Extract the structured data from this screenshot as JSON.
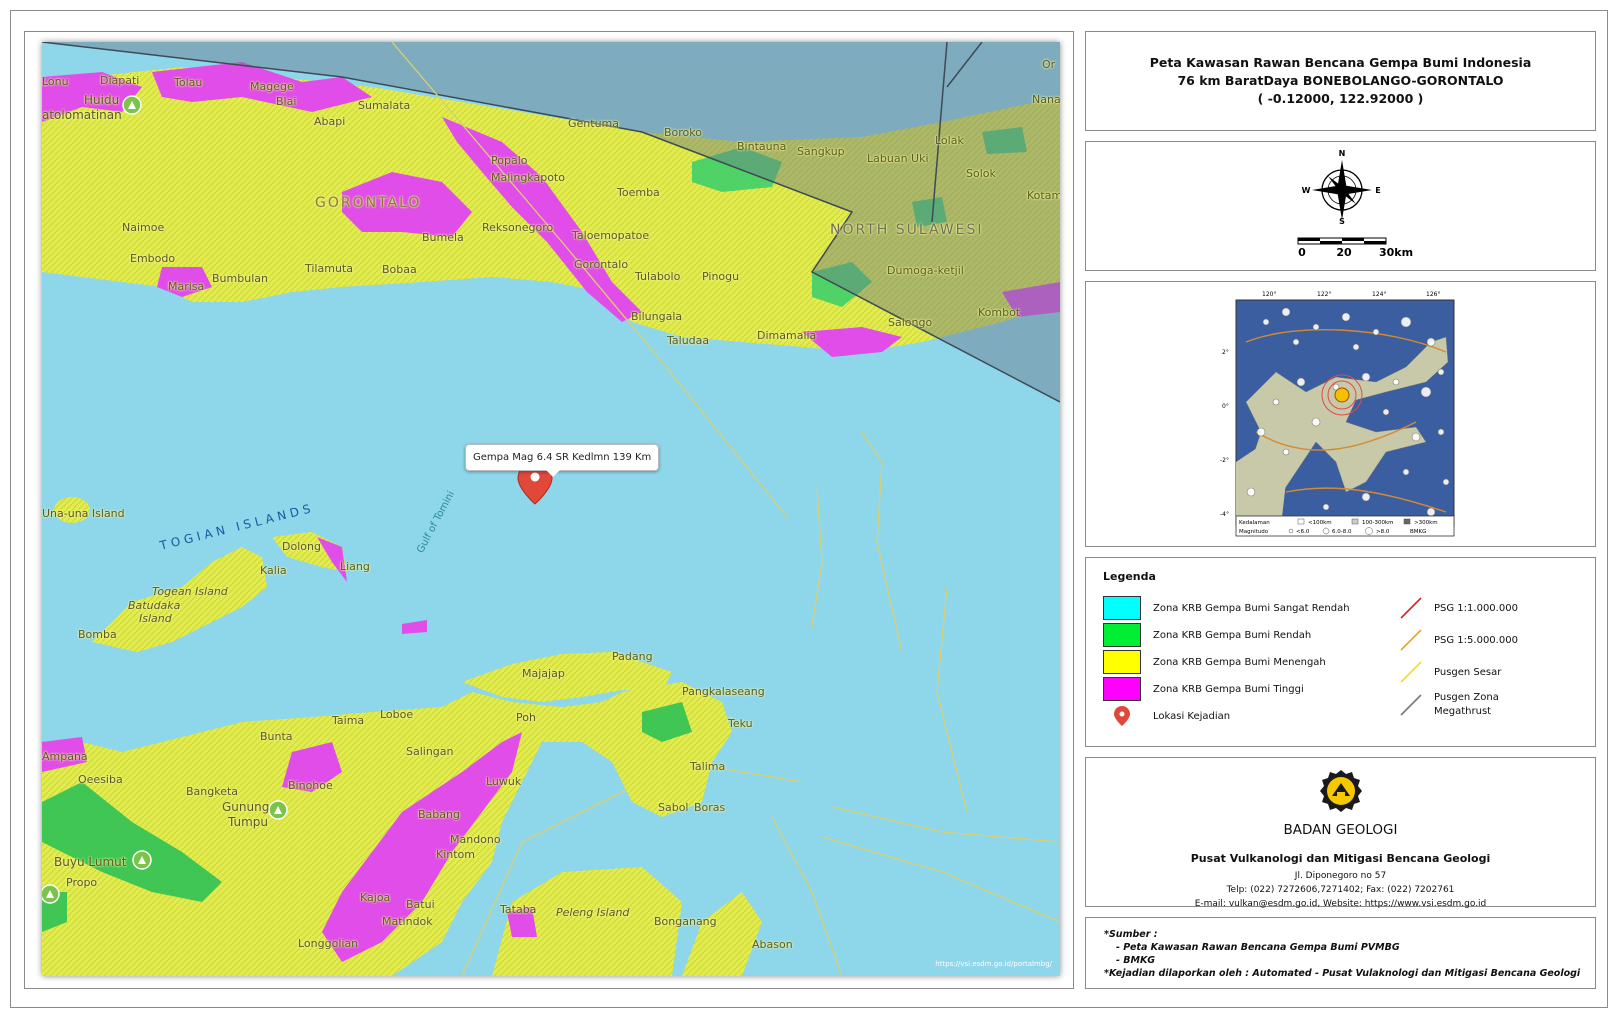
{
  "map": {
    "labels": {
      "gorontalo": "GORONTALO",
      "north_sulawesi": "NORTH SULAWESI",
      "togian_islands": "TOGIAN ISLANDS",
      "gulf_of_tomini": "Gulf of Tomini",
      "lonu": "Lonu",
      "diapati": "Diapati",
      "tolau": "Tolau",
      "magege": "Magege",
      "huidu": "Huidu",
      "atolomatinan": "atolomatinan",
      "blai": "Blai",
      "sumalata": "Sumalata",
      "abapi": "Abapi",
      "gentuma": "Gentuma",
      "boroko": "Boroko",
      "bintauna": "Bintauna",
      "sangkup": "Sangkup",
      "labuan_uki": "Labuan Uki",
      "lolak": "Lolak",
      "nana": "Nana",
      "solok": "Solok",
      "kotam": "Kotam",
      "or": "Or",
      "popalo": "Popalo",
      "malingkapoto": "Malingkapoto",
      "toemba": "Toemba",
      "naimoe": "Naimoe",
      "reksonegoro": "Reksonegoro",
      "bumela": "Bumela",
      "taloembatoe": "Taloemopatoe",
      "embodo": "Embodo",
      "gorontalo_city": "Gorontalo",
      "bumbulan": "Bumbulan",
      "tilamuta": "Tilamuta",
      "bobaa": "Bobaa",
      "marisa": "Marisa",
      "tulabolo": "Tulabolo",
      "pinogu": "Pinogu",
      "dumoga": "Dumoga-ketjil",
      "bilungala": "Bilungala",
      "dimamalia": "Dimamalia",
      "taludaa": "Taludaa",
      "salongo": "Salongo",
      "kombot": "Kombot",
      "una_una": "Una-una Island",
      "dolong": "Dolong",
      "kalia": "Kalia",
      "liang": "Liang",
      "togean": "Togean Island",
      "batudaka": "Batudaka",
      "island": "Island",
      "bomba": "Bomba",
      "padang": "Padang",
      "majajap": "Majajap",
      "pangkalaseang": "Pangkalaseang",
      "taima": "Taima",
      "loboe": "Loboe",
      "poh": "Poh",
      "teku": "Teku",
      "bunta": "Bunta",
      "salingan": "Salingan",
      "ampana": "Ampana",
      "oeesiba": "Oeesiba",
      "bangketa": "Bangketa",
      "binohoe": "Binohoe",
      "luwuk": "Luwuk",
      "talima": "Talima",
      "gunung": "Gunung",
      "tumpu": "Tumpu",
      "sabol": "Sabol",
      "boras": "Boras",
      "babang": "Babang",
      "buyu_lumut": "Buyu Lumut",
      "mandono": "Mandono",
      "kintom": "Kintom",
      "propo": "Propo",
      "kajoa": "Kajoa",
      "batui": "Batui",
      "matindok": "Matindok",
      "tataba": "Tataba",
      "peleng": "Peleng Island",
      "bonganang": "Bonganang",
      "longgolian": "Longgolian",
      "abason": "Abason"
    },
    "popup": "Gempa Mag 6.4 SR Kedlmn 139 Km",
    "credit": "https://vsi.esdm.go.id/portalmbg/"
  },
  "title": {
    "line1": "Peta Kawasan Rawan Bencana Gempa Bumi Indonesia",
    "line2": "76 km BaratDaya BONEBOLANGO-GORONTALO",
    "line3": "( -0.12000, 122.92000 )"
  },
  "compass": {
    "n": "N",
    "s": "S",
    "e": "E",
    "w": "W"
  },
  "scale": {
    "t0": "0",
    "t1": "20",
    "t2": "30km"
  },
  "inset": {
    "lon_ticks": [
      "120°",
      "122°",
      "124°",
      "126°"
    ],
    "lat_ticks": [
      "2°",
      "0°",
      "-2°",
      "-4°"
    ],
    "legend_row1": [
      "Kedalaman",
      "<100km",
      "100-300km",
      ">300km"
    ],
    "legend_row2": [
      "Magnitudo",
      "<6.0",
      "6.0-8.0",
      ">8.0",
      "BMKG"
    ]
  },
  "legend": {
    "title": "Legenda",
    "zones": [
      {
        "label": "Zona KRB Gempa Bumi Sangat Rendah",
        "color": "#00ffff"
      },
      {
        "label": "Zona KRB Gempa Bumi Rendah",
        "color": "#00ee33"
      },
      {
        "label": "Zona KRB Gempa Bumi Menengah",
        "color": "#ffff00"
      },
      {
        "label": "Zona KRB Gempa Bumi Tinggi",
        "color": "#ff00ff"
      }
    ],
    "location": "Lokasi Kejadian",
    "lines": [
      {
        "label": "PSG 1:1.000.000",
        "color": "#e02020"
      },
      {
        "label": "PSG 1:5.000.000",
        "color": "#f0a020"
      },
      {
        "label": "Pusgen Sesar",
        "color": "#f0e020"
      },
      {
        "label": "Pusgen Zona Megathrust",
        "color": "#777777"
      }
    ]
  },
  "org": {
    "name": "BADAN GEOLOGI",
    "sub": "Pusat Vulkanologi dan Mitigasi Bencana Geologi",
    "address": "Jl. Diponegoro no 57",
    "phone": "Telp: (022) 7272606,7271402; Fax: (022) 7202761",
    "email": "E-mail: vulkan@esdm.go.id, Website: https://www.vsi.esdm.go.id"
  },
  "source": {
    "line1": "*Sumber :",
    "line2": "- Peta Kawasan Rawan Bencana Gempa Bumi PVMBG",
    "line3": "- BMKG",
    "line4": "*Kejadian dilaporkan oleh : Automated - Pusat Vulaknologi dan Mitigasi Bencana Geologi"
  }
}
